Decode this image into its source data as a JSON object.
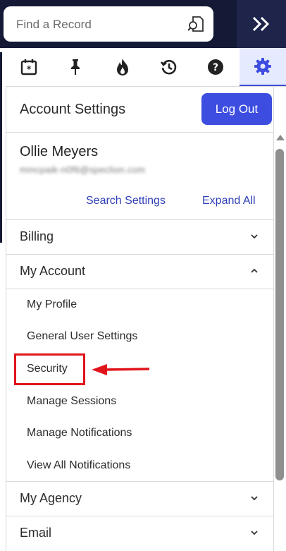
{
  "search": {
    "placeholder": "Find a Record"
  },
  "tabs": [
    {
      "name": "calendar-star-icon"
    },
    {
      "name": "pin-icon"
    },
    {
      "name": "flame-icon"
    },
    {
      "name": "history-icon"
    },
    {
      "name": "help-icon"
    },
    {
      "name": "gear-icon",
      "active": true
    }
  ],
  "header": {
    "title": "Account Settings",
    "logout_label": "Log Out"
  },
  "user": {
    "name": "Ollie Meyers",
    "email": "mmcpaik-n0f6@speclion.com"
  },
  "links": {
    "search_settings": "Search Settings",
    "expand_all": "Expand All"
  },
  "sections": {
    "billing": "Billing",
    "my_account": "My Account",
    "my_agency": "My Agency",
    "email": "Email"
  },
  "my_account_items": [
    "My Profile",
    "General User Settings",
    "Security",
    "Manage Sessions",
    "Manage Notifications",
    "View All Notifications"
  ],
  "colors": {
    "topbar": "#141935",
    "accent": "#3d4de0",
    "link": "#2f3fb7",
    "highlight": "#e0141b"
  }
}
